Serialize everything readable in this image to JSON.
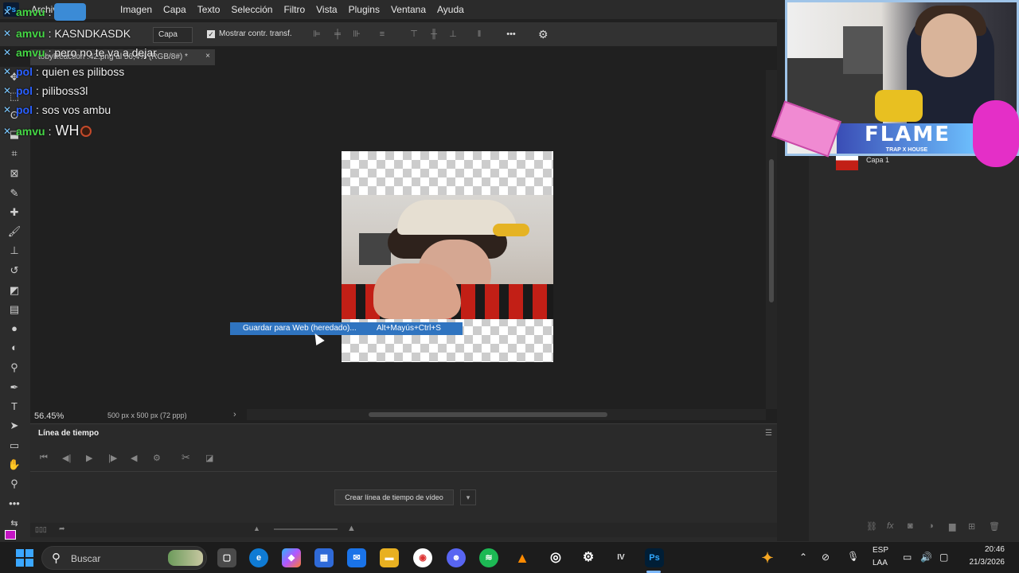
{
  "menubar": {
    "items": [
      "Archivo",
      "Imagen",
      "Capa",
      "Texto",
      "Selección",
      "Filtro",
      "Vista",
      "Plugins",
      "Ventana",
      "Ayuda"
    ]
  },
  "optionsbar": {
    "select_value": "Capa",
    "checkbox_label": "Mostrar contr. transf."
  },
  "document": {
    "tab_title": "tobyReaction .42.png al 56,4% (RGB/8#) *",
    "zoom": "56.45%",
    "size_info": "500 px x 500 px (72 ppp)"
  },
  "context_menu": {
    "label": "Guardar para Web (heredado)...",
    "shortcut": "Alt+Mayús+Ctrl+S"
  },
  "timeline": {
    "title": "Línea de tiempo",
    "create_button": "Crear línea de tiempo de vídeo"
  },
  "layers": {
    "layer_name": "Capa 1"
  },
  "chat": [
    {
      "user": "amvu",
      "color": "green",
      "text": "",
      "emote": true
    },
    {
      "user": "amvu",
      "color": "green",
      "text": "KASNDKASDK"
    },
    {
      "user": "amvu",
      "color": "green",
      "text": "pero no te va a dejar"
    },
    {
      "user": "pol",
      "color": "blue",
      "text": "quien es piliboss"
    },
    {
      "user": "pol",
      "color": "blue",
      "text": "piliboss3l"
    },
    {
      "user": "pol",
      "color": "blue",
      "text": "sos vos ambu"
    },
    {
      "user": "amvu",
      "color": "green",
      "text": "WH"
    }
  ],
  "stream_overlay": {
    "banner_title": "FLAME",
    "banner_subtitle": "TRAP X HOUSE"
  },
  "taskbar": {
    "search_placeholder": "Buscar",
    "lang_top": "ESP",
    "lang_bottom": "LAA",
    "time": "20:46",
    "date": "21/3/2026"
  },
  "colors": {
    "accent_blue": "#2f74c0",
    "chat_green": "#45d645",
    "chat_blue": "#2a5fff"
  }
}
